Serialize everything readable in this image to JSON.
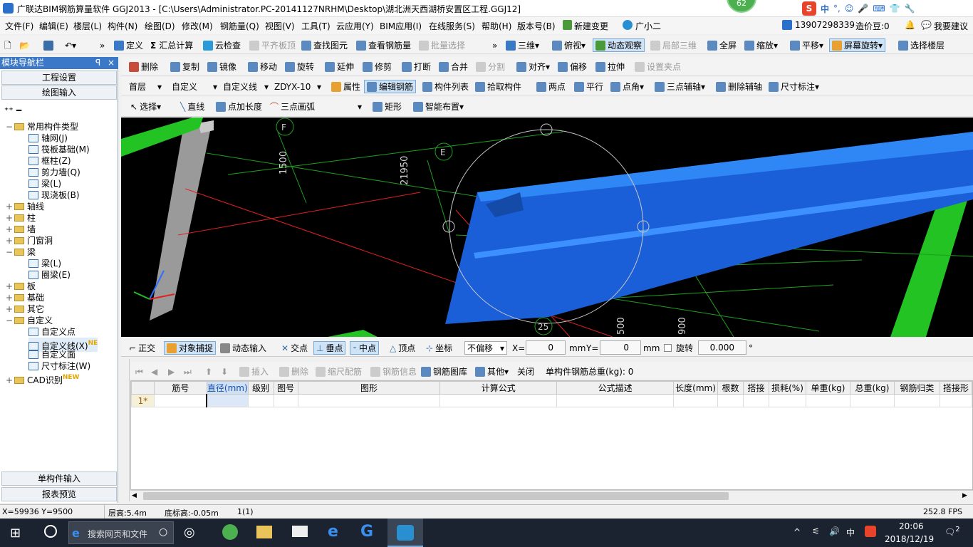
{
  "title": "广联达BIM钢筋算量软件 GGJ2013 - [C:\\Users\\Administrator.PC-20141127NRHM\\Desktop\\湖北洲天西湖桥安置区工程.GGJ12]",
  "badge": "62",
  "ime": {
    "lang": "中",
    "symbol": "°,"
  },
  "menu": [
    "文件(F)",
    "编辑(E)",
    "楼层(L)",
    "构件(N)",
    "绘图(D)",
    "修改(M)",
    "钢筋量(Q)",
    "视图(V)",
    "工具(T)",
    "云应用(Y)",
    "BIM应用(I)",
    "在线服务(S)",
    "帮助(H)",
    "版本号(B)",
    "新建变更",
    "广小二"
  ],
  "user": {
    "phone": "13907298339",
    "bean": "造价豆:0",
    "suggest": "我要建议"
  },
  "toolbar1": [
    "定义",
    "汇总计算",
    "云检查",
    "平齐板顶",
    "查找图元",
    "查看钢筋量",
    "批量选择",
    "三维",
    "俯视",
    "动态观察",
    "局部三维",
    "全屏",
    "缩放",
    "平移",
    "屏幕旋转",
    "选择楼层"
  ],
  "toolbar2": [
    "删除",
    "复制",
    "镜像",
    "移动",
    "旋转",
    "延伸",
    "修剪",
    "打断",
    "合并",
    "分割",
    "对齐",
    "偏移",
    "拉伸",
    "设置夹点"
  ],
  "toolbar3": {
    "floor": "首层",
    "cat": "自定义",
    "type": "自定义线",
    "name": "ZDYX-10",
    "items": [
      "属性",
      "编辑钢筋",
      "构件列表",
      "拾取构件",
      "两点",
      "平行",
      "点角",
      "三点辅轴",
      "删除辅轴",
      "尺寸标注"
    ]
  },
  "toolbar4": [
    "选择",
    "直线",
    "点加长度",
    "三点画弧",
    "矩形",
    "智能布置"
  ],
  "nav": {
    "header": "模块导航栏",
    "pin": "ꟼ",
    "close": "×",
    "btn_project": "工程设置",
    "btn_draw": "绘图输入",
    "btn_single": "单构件输入",
    "btn_report": "报表预览",
    "tree": [
      {
        "t": "常用构件类型",
        "lvl": 0,
        "exp": "−",
        "fold": true
      },
      {
        "t": "轴网(J)",
        "lvl": 1
      },
      {
        "t": "筏板基础(M)",
        "lvl": 1
      },
      {
        "t": "框柱(Z)",
        "lvl": 1
      },
      {
        "t": "剪力墙(Q)",
        "lvl": 1
      },
      {
        "t": "梁(L)",
        "lvl": 1
      },
      {
        "t": "现浇板(B)",
        "lvl": 1
      },
      {
        "t": "轴线",
        "lvl": 0,
        "exp": "+",
        "fold": true
      },
      {
        "t": "柱",
        "lvl": 0,
        "exp": "+",
        "fold": true
      },
      {
        "t": "墙",
        "lvl": 0,
        "exp": "+",
        "fold": true
      },
      {
        "t": "门窗洞",
        "lvl": 0,
        "exp": "+",
        "fold": true
      },
      {
        "t": "梁",
        "lvl": 0,
        "exp": "−",
        "fold": true
      },
      {
        "t": "梁(L)",
        "lvl": 1
      },
      {
        "t": "圈梁(E)",
        "lvl": 1
      },
      {
        "t": "板",
        "lvl": 0,
        "exp": "+",
        "fold": true
      },
      {
        "t": "基础",
        "lvl": 0,
        "exp": "+",
        "fold": true
      },
      {
        "t": "其它",
        "lvl": 0,
        "exp": "+",
        "fold": true
      },
      {
        "t": "自定义",
        "lvl": 0,
        "exp": "−",
        "fold": true
      },
      {
        "t": "自定义点",
        "lvl": 1
      },
      {
        "t": "自定义线(X)",
        "lvl": 1,
        "sel": true,
        "new": "NE"
      },
      {
        "t": "自定义面",
        "lvl": 1
      },
      {
        "t": "尺寸标注(W)",
        "lvl": 1
      },
      {
        "t": "CAD识别",
        "lvl": 0,
        "exp": "+",
        "fold": true,
        "new": "NEW"
      }
    ]
  },
  "viewport": {
    "labels": [
      "F",
      "E",
      "25"
    ],
    "dims": [
      "1500",
      "21950",
      "500",
      "900"
    ]
  },
  "snap": {
    "items": [
      "正交",
      "对象捕捉",
      "动态输入",
      "交点",
      "垂点",
      "中点",
      "顶点",
      "坐标"
    ],
    "offset": "不偏移",
    "x_label": "X=",
    "x": "0",
    "y_label": "Y=",
    "y": "0",
    "unit": "mm",
    "rotate": "旋转",
    "angle": "0.000",
    "deg": "°"
  },
  "rebar": {
    "items": [
      "插入",
      "删除",
      "缩尺配筋",
      "钢筋信息",
      "钢筋图库",
      "其他",
      "关闭"
    ],
    "total": "单构件钢筋总重(kg): 0"
  },
  "grid": {
    "cols": [
      "筋号",
      "直径(mm)",
      "级别",
      "图号",
      "图形",
      "计算公式",
      "公式描述",
      "长度(mm)",
      "根数",
      "搭接",
      "损耗(%)",
      "单重(kg)",
      "总重(kg)",
      "钢筋归类",
      "搭接形"
    ],
    "row": "1*"
  },
  "status": {
    "coord": "X=59936 Y=9500",
    "floorh": "层高:5.4m",
    "base": "底标高:-0.05m",
    "count": "1(1)",
    "fps": "252.8 FPS"
  },
  "taskbar": {
    "search": "搜索网页和文件",
    "time": "20:06",
    "date": "2018/12/19",
    "lang": "中",
    "notif": "2"
  }
}
